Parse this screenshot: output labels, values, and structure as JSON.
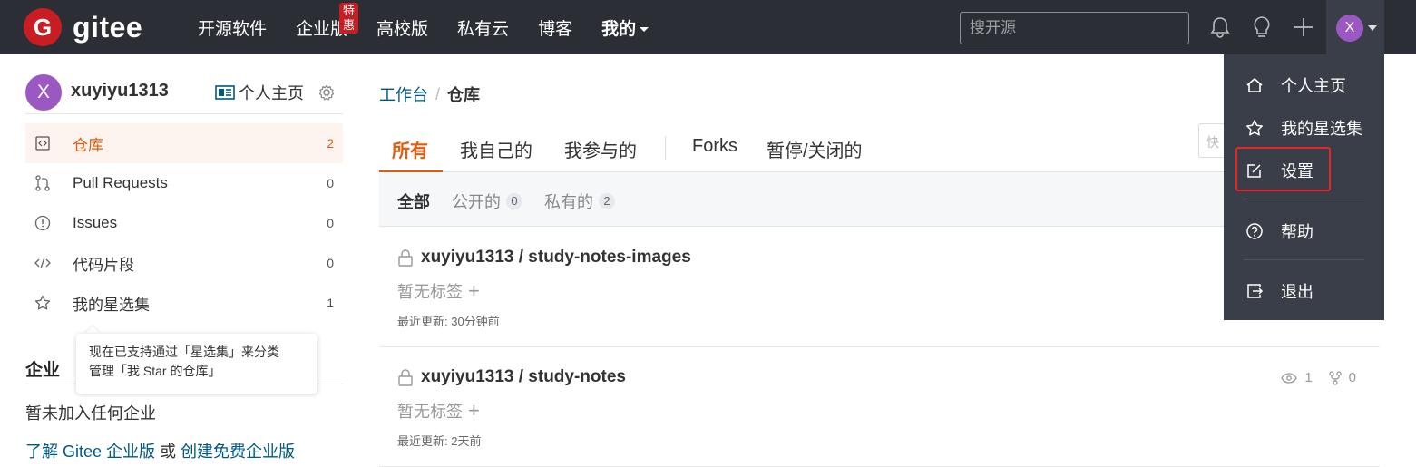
{
  "topbar": {
    "logo_letter": "G",
    "logo_text": "gitee",
    "nav": [
      {
        "label": "开源软件"
      },
      {
        "label": "企业版",
        "badge": "特惠"
      },
      {
        "label": "高校版"
      },
      {
        "label": "私有云"
      },
      {
        "label": "博客"
      },
      {
        "label": "我的"
      }
    ],
    "search_placeholder": "搜开源",
    "avatar_letter": "X",
    "icons": [
      "bell-icon",
      "lightbulb-icon",
      "plus-icon"
    ],
    "bg_color": "#2b2e35"
  },
  "sidebar": {
    "avatar_letter": "X",
    "username": "xuyiyu1313",
    "profile_link": "个人主页",
    "items": [
      {
        "icon": "repo-icon",
        "label": "仓库",
        "count": "2",
        "active": true
      },
      {
        "icon": "pull-request-icon",
        "label": "Pull Requests",
        "count": "0"
      },
      {
        "icon": "issue-icon",
        "label": "Issues",
        "count": "0"
      },
      {
        "icon": "code-icon",
        "label": "代码片段",
        "count": "0"
      },
      {
        "icon": "star-icon",
        "label": "我的星选集",
        "count": "1"
      }
    ],
    "tooltip_line1": "现在已支持通过「星选集」来分类",
    "tooltip_line2": "管理「我 Star 的仓库」",
    "enterprise_title": "企业",
    "enterprise_none": "暂未加入任何企业",
    "enterprise_link1": "了解 Gitee 企业版",
    "enterprise_or": "或",
    "enterprise_link2": "创建免费企业版"
  },
  "main": {
    "breadcrumb_root": "工作台",
    "breadcrumb_sep": "/",
    "breadcrumb_current": "仓库",
    "tabs": [
      "所有",
      "我自己的",
      "我参与的",
      "Forks",
      "暂停/关闭的"
    ],
    "quick_placeholder": "快",
    "filters": [
      {
        "label": "全部"
      },
      {
        "label": "公开的",
        "count": "0"
      },
      {
        "label": "私有的",
        "count": "2"
      }
    ],
    "repos": [
      {
        "name": "xuyiyu1313 / study-notes-images",
        "tags": "暂无标签",
        "updated": "最近更新: 30分钟前"
      },
      {
        "name": "xuyiyu1313 / study-notes",
        "tags": "暂无标签",
        "updated": "最近更新: 2天前",
        "watchers": "1",
        "forks": "0"
      }
    ],
    "accent_color": "#e35b0f"
  },
  "dropdown": {
    "items": [
      {
        "icon": "home-icon",
        "label": "个人主页"
      },
      {
        "icon": "star-icon",
        "label": "我的星选集"
      },
      {
        "icon": "edit-icon",
        "label": "设置"
      },
      {
        "icon": "help-icon",
        "label": "帮助"
      },
      {
        "icon": "logout-icon",
        "label": "退出"
      }
    ],
    "highlight_color": "#e8262a"
  }
}
